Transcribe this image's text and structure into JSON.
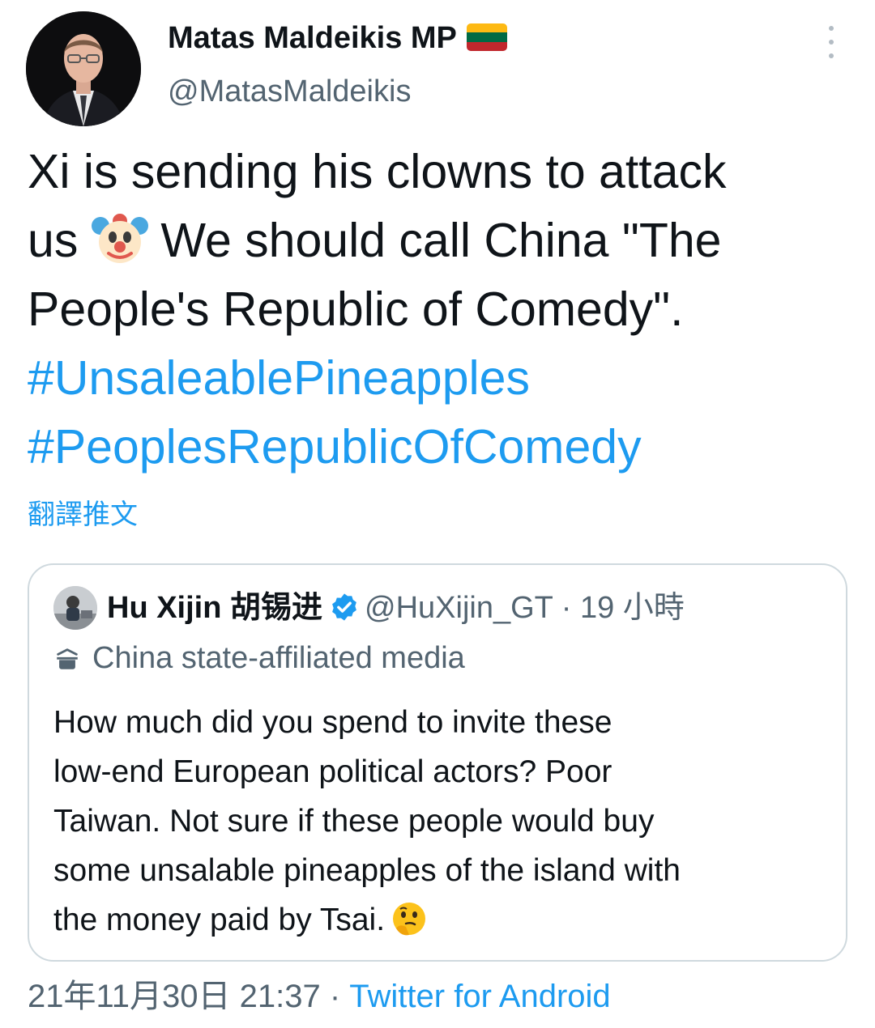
{
  "author": {
    "name": "Matas Maldeikis MP",
    "handle": "@MatasMaldeikis",
    "flag_colors": [
      "#fdb913",
      "#006a44",
      "#c1272d"
    ]
  },
  "tweet": {
    "text_lines": [
      "Xi is sending his clowns to attack",
      "us",
      "We should call China \"The",
      "People's Republic of Comedy\"."
    ],
    "emoji": "clown-face",
    "hashtags": [
      "#UnsaleablePineapples",
      "#PeoplesRepublicOfComedy"
    ],
    "translate_label": "翻譯推文"
  },
  "quoted_tweet": {
    "name": "Hu Xijin 胡锡进",
    "verified": true,
    "handle": "@HuXijin_GT",
    "separator": "·",
    "time": "19 小時",
    "label_icon": "state-media-icon",
    "label": "China state-affiliated media",
    "text_lines": [
      "How much did you spend to invite these",
      "low-end European political actors? Poor",
      "Taiwan. Not sure if these people would buy",
      "some unsalable pineapples of the island with",
      "the money paid by Tsai."
    ],
    "emoji": "thinking-face"
  },
  "footer": {
    "timestamp": "21年11月30日 21:37",
    "separator": "·",
    "source": "Twitter for Android"
  },
  "colors": {
    "accent": "#1d9bf0",
    "text": "#0f1419",
    "muted": "#536471",
    "border": "#cfd9de"
  }
}
